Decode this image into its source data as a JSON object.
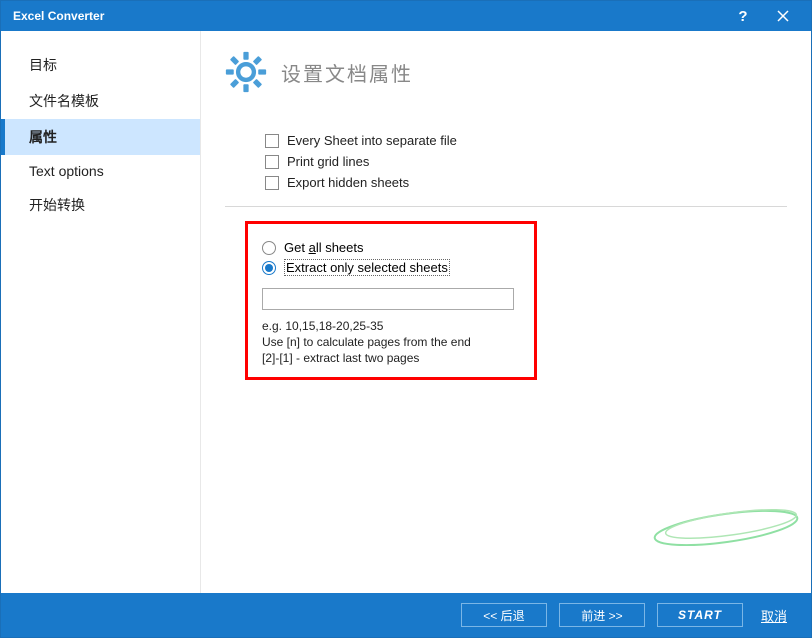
{
  "title": "Excel Converter",
  "sidebar": {
    "items": [
      {
        "label": "目标"
      },
      {
        "label": "文件名模板"
      },
      {
        "label": "属性"
      },
      {
        "label": "Text options"
      },
      {
        "label": "开始转换"
      }
    ],
    "selectedIndex": 2
  },
  "header": {
    "title": "设置文档属性"
  },
  "options": {
    "separate_file": "Every Sheet into separate file",
    "print_grid": "Print grid lines",
    "export_hidden": "Export hidden sheets"
  },
  "sheets": {
    "get_all_prefix": "Get ",
    "get_all_underlined": "a",
    "get_all_suffix": "ll sheets",
    "extract_selected": "Extract only selected sheets",
    "input_value": "",
    "hint_line1": "e.g. 10,15,18-20,25-35",
    "hint_line2": "Use [n] to calculate pages from the end",
    "hint_line3": "[2]-[1] - extract last two pages"
  },
  "footer": {
    "back": "<< 后退",
    "forward": "前进 >>",
    "start": "START",
    "cancel": "取消"
  }
}
